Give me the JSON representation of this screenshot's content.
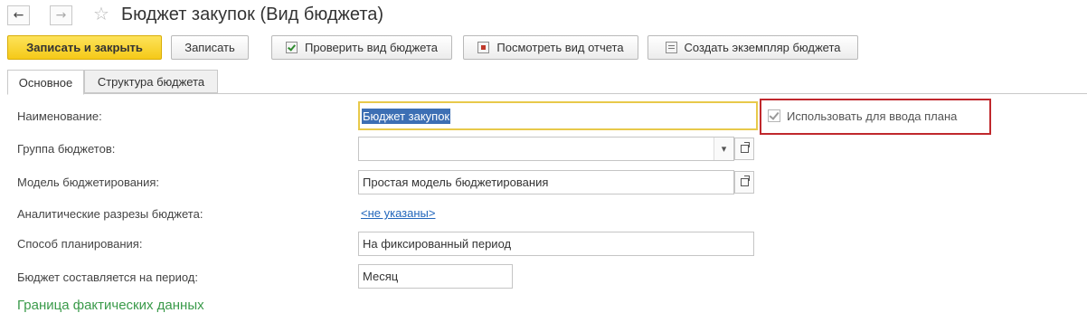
{
  "window": {
    "title": "Бюджет закупок (Вид бюджета)",
    "back_glyph": "←",
    "forward_glyph": "→",
    "favorite_glyph": "☆"
  },
  "toolbar": {
    "save_close": "Записать и закрыть",
    "save": "Записать",
    "check": "Проверить вид бюджета",
    "view_report": "Посмотреть вид отчета",
    "create_instance": "Создать экземпляр бюджета"
  },
  "tabs": [
    {
      "label": "Основное",
      "active": true
    },
    {
      "label": "Структура бюджета",
      "active": false
    }
  ],
  "form": {
    "name": {
      "label": "Наименование:",
      "value": "Бюджет закупок"
    },
    "use_for_plan": {
      "label": "Использовать для ввода плана",
      "checked": true
    },
    "group": {
      "label": "Группа бюджетов:",
      "value": "",
      "dropdown_glyph": "▾"
    },
    "model": {
      "label": "Модель бюджетирования:",
      "value": "Простая модель бюджетирования"
    },
    "analytics": {
      "label": "Аналитические разрезы бюджета:",
      "link": "<не указаны>"
    },
    "planning_method": {
      "label": "Способ планирования:",
      "value": "На фиксированный период"
    },
    "period": {
      "label": "Бюджет составляется на период:",
      "value": "Месяц"
    },
    "section_heading": "Граница фактических данных"
  },
  "colors": {
    "primary_button": "#f5c918",
    "highlight_border": "#c0282d",
    "link": "#2266bb",
    "section_heading": "#3a9a4a",
    "focus_border": "#e8c94a"
  }
}
